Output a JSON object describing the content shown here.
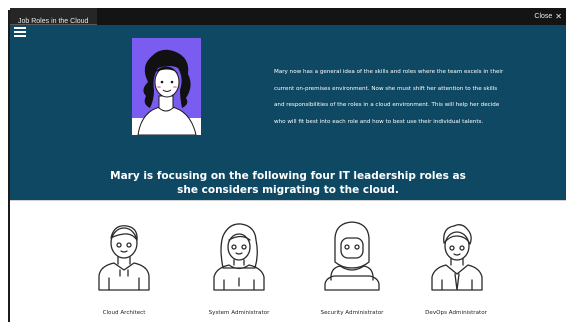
{
  "window": {
    "tab_title": "Job Roles in the Cloud",
    "close_label": "Close",
    "close_icon": "close-icon"
  },
  "hero": {
    "background": "#0e4863",
    "portrait_accent": "#7b5cf0",
    "intro": "Mary now has a general idea of the skills and roles where the team excels in their current on-premises environment. Now she must shift her attention to the skills and responsibilities of the roles in a cloud environment. This will help her decide who will fit best into each role and how to best use their individual talents.",
    "headline": "Mary is focusing on the following four IT leadership roles as she considers migrating to the cloud."
  },
  "roles": [
    {
      "label": "Cloud Architect",
      "icon": "cloud-architect-icon"
    },
    {
      "label": "System Administrator",
      "icon": "system-administrator-icon"
    },
    {
      "label": "Security Administrator",
      "icon": "security-administrator-icon"
    },
    {
      "label": "DevOps Administrator",
      "icon": "devops-administrator-icon"
    }
  ]
}
